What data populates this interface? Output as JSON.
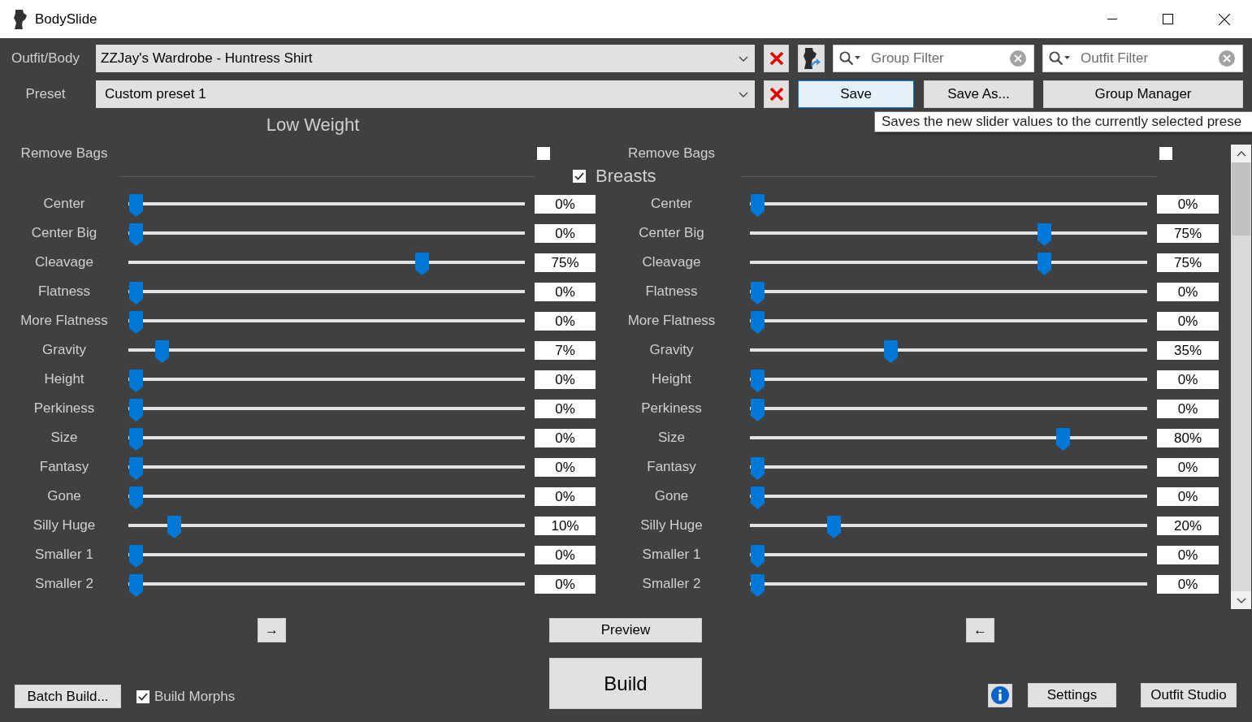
{
  "window": {
    "title": "BodySlide"
  },
  "toolbar": {
    "outfit": {
      "label": "Outfit/Body",
      "value": "ZZJay's Wardrobe - Huntress Shirt"
    },
    "preset": {
      "label": "Preset",
      "value": "Custom preset 1"
    },
    "group_filter": {
      "placeholder": "Group Filter"
    },
    "outfit_filter": {
      "placeholder": "Outfit Filter"
    },
    "preset_buttons": [
      {
        "label": "Save",
        "hovered": true
      },
      {
        "label": "Save As...",
        "hovered": false
      },
      {
        "label": "Group Manager",
        "hovered": false
      }
    ]
  },
  "tooltip": {
    "text": "Saves the new slider values to the currently selected prese"
  },
  "low_weight": {
    "title": "Low Weight",
    "remove_bags": {
      "label": "Remove Bags",
      "checked": false
    },
    "sliders": [
      {
        "name": "Center",
        "level": 0,
        "reading": "0%"
      },
      {
        "name": "Center Big",
        "level": 0,
        "reading": "0%"
      },
      {
        "name": "Cleavage",
        "level": 0.75,
        "reading": "75%"
      },
      {
        "name": "Flatness",
        "level": 0,
        "reading": "0%"
      },
      {
        "name": "More Flatness",
        "level": 0,
        "reading": "0%"
      },
      {
        "name": "Gravity",
        "level": 0.07,
        "reading": "7%"
      },
      {
        "name": "Height",
        "level": 0,
        "reading": "0%"
      },
      {
        "name": "Perkiness",
        "level": 0,
        "reading": "0%"
      },
      {
        "name": "Size",
        "level": 0,
        "reading": "0%"
      },
      {
        "name": "Fantasy",
        "level": 0,
        "reading": "0%"
      },
      {
        "name": "Gone",
        "level": 0,
        "reading": "0%"
      },
      {
        "name": "Silly Huge",
        "level": 0.1,
        "reading": "10%"
      },
      {
        "name": "Smaller 1",
        "level": 0,
        "reading": "0%"
      },
      {
        "name": "Smaller 2",
        "level": 0,
        "reading": "0%"
      }
    ]
  },
  "category": {
    "label": "Breasts",
    "checked": true
  },
  "column_2": {
    "remove_bags": {
      "label": "Remove Bags",
      "checked": false
    },
    "sliders": [
      {
        "name": "Center",
        "level": 0,
        "reading": "0%"
      },
      {
        "name": "Center Big",
        "level": 0.75,
        "reading": "75%"
      },
      {
        "name": "Cleavage",
        "level": 0.75,
        "reading": "75%"
      },
      {
        "name": "Flatness",
        "level": 0,
        "reading": "0%"
      },
      {
        "name": "More Flatness",
        "level": 0,
        "reading": "0%"
      },
      {
        "name": "Gravity",
        "level": 0.35,
        "reading": "35%"
      },
      {
        "name": "Height",
        "level": 0,
        "reading": "0%"
      },
      {
        "name": "Perkiness",
        "level": 0,
        "reading": "0%"
      },
      {
        "name": "Size",
        "level": 0.8,
        "reading": "80%"
      },
      {
        "name": "Fantasy",
        "level": 0,
        "reading": "0%"
      },
      {
        "name": "Gone",
        "level": 0,
        "reading": "0%"
      },
      {
        "name": "Silly Huge",
        "level": 0.2,
        "reading": "20%"
      },
      {
        "name": "Smaller 1",
        "level": 0,
        "reading": "0%"
      },
      {
        "name": "Smaller 2",
        "level": 0,
        "reading": "0%"
      }
    ]
  },
  "footer": {
    "right_arrow_button": "→",
    "preview_button": "Preview",
    "left_arrow_button": "←",
    "build_button": "Build",
    "batch_build_button": "Batch Build...",
    "build_morphs": {
      "label": "Build Morphs",
      "checked": true
    },
    "settings_button": "Settings",
    "outfit_studio_button": "Outfit Studio"
  }
}
